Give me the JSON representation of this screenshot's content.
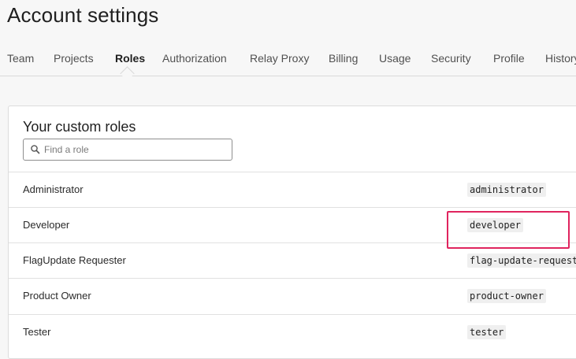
{
  "page": {
    "title": "Account settings"
  },
  "tabs": [
    {
      "label": "Team",
      "active": false
    },
    {
      "label": "Projects",
      "active": false
    },
    {
      "label": "Roles",
      "active": true
    },
    {
      "label": "Authorization",
      "active": false
    },
    {
      "label": "Relay Proxy",
      "active": false
    },
    {
      "label": "Billing",
      "active": false
    },
    {
      "label": "Usage",
      "active": false
    },
    {
      "label": "Security",
      "active": false
    },
    {
      "label": "Profile",
      "active": false
    },
    {
      "label": "History",
      "active": false
    }
  ],
  "roles_panel": {
    "title": "Your custom roles",
    "search": {
      "placeholder": "Find a role",
      "value": "",
      "icon": "search-icon"
    },
    "rows": [
      {
        "name": "Administrator",
        "key": "administrator"
      },
      {
        "name": "Developer",
        "key": "developer"
      },
      {
        "name": "FlagUpdate Requester",
        "key": "flag-update-requester"
      },
      {
        "name": "Product Owner",
        "key": "product-owner"
      },
      {
        "name": "Tester",
        "key": "tester"
      }
    ]
  },
  "colors": {
    "highlight": "#e0245e",
    "background": "#f7f7f7",
    "card": "#ffffff"
  }
}
